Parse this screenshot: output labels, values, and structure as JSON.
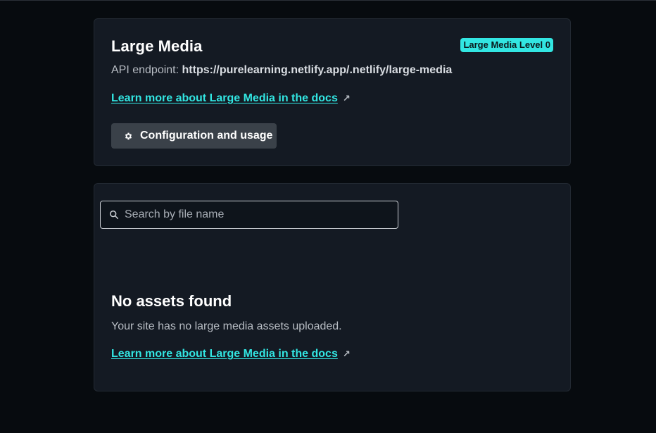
{
  "large_media": {
    "title": "Large Media",
    "badge": "Large Media Level 0",
    "endpoint_label": "API endpoint:",
    "endpoint_url": "https://purelearning.netlify.app/.netlify/large-media",
    "docs_link": "Learn more about Large Media in the docs",
    "config_button": "Configuration and usage",
    "icons": [
      "gear-icon",
      "external-arrow-icon"
    ]
  },
  "assets": {
    "search": {
      "placeholder": "Search by file name",
      "value": ""
    },
    "empty_title": "No assets found",
    "empty_description": "Your site has no large media assets uploaded.",
    "docs_link": "Learn more about Large Media in the docs",
    "icons": [
      "search-icon",
      "external-arrow-icon"
    ]
  },
  "colors": {
    "background": "#070b0f",
    "card": "#141a23",
    "accent": "#32e6e2",
    "button": "#3a4149"
  }
}
